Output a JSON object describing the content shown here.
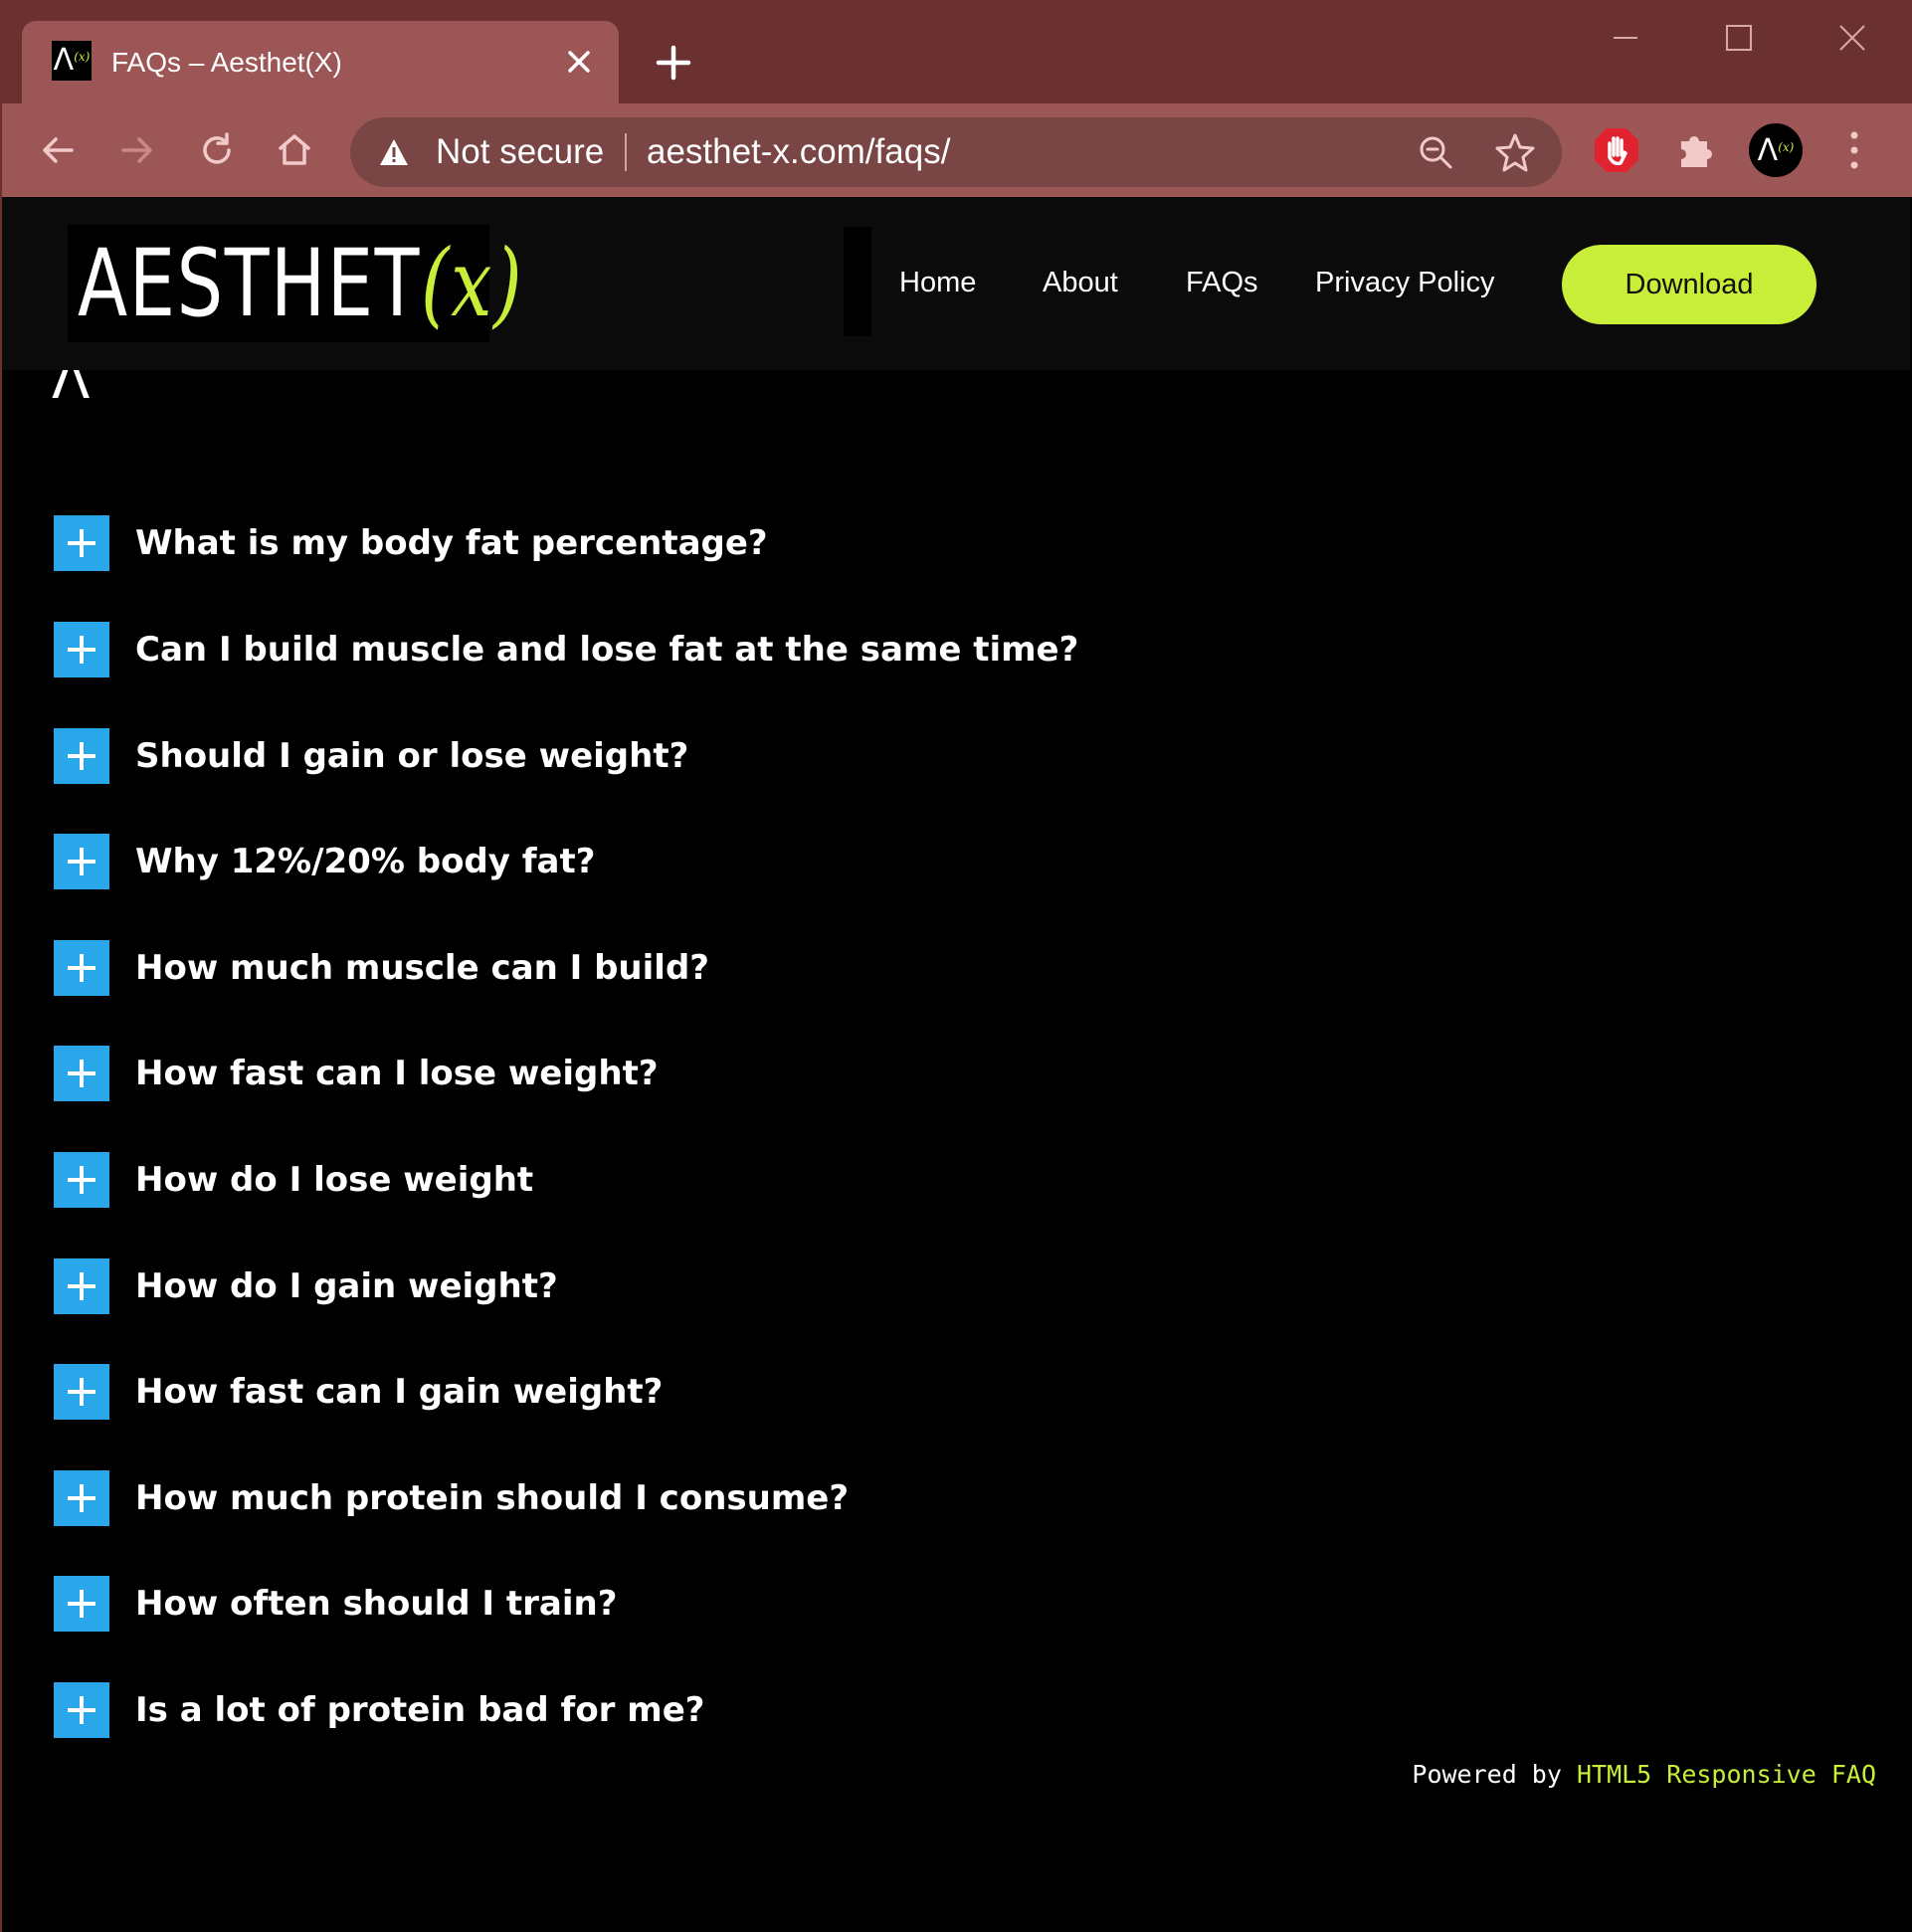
{
  "browser": {
    "tab_title": "FAQs – Aesthet(X)",
    "favicon_lambda": "Λ",
    "favicon_x": "(x)",
    "security_label": "Not secure",
    "url": "aesthet-x.com/faqs/",
    "colors": {
      "frame": "#6b3131",
      "tab": "#9c5656",
      "omnibox": "#7a4545"
    }
  },
  "site": {
    "logo_text": "AESTHET",
    "logo_x": "(x)",
    "nav": {
      "home": "Home",
      "about": "About",
      "faqs": "FAQs",
      "privacy": "Privacy Policy",
      "download": "Download"
    },
    "accent": "#c8ee3a",
    "ghost_glyph": "Λ"
  },
  "faqs": [
    "What is my body fat percentage?",
    "Can I build muscle and lose fat at the same time?",
    "Should I gain or lose weight?",
    "Why 12%/20% body fat?",
    "How much muscle can I build?",
    "How fast can I lose weight?",
    "How do I lose weight",
    "How do I gain weight?",
    "How fast can I gain weight?",
    "How much protein should I consume?",
    "How often should I train?",
    "Is a lot of protein bad for me?"
  ],
  "footer": {
    "powered_by": "Powered by",
    "link_text": "HTML5 Responsive FAQ"
  },
  "plus_color": "#2aa7ea"
}
